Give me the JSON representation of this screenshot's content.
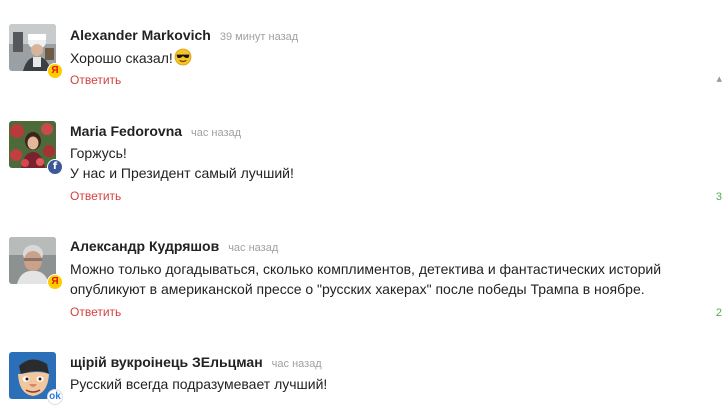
{
  "comments": [
    {
      "author": "Alexander Markovich",
      "time": "39 минут назад",
      "lines": [
        "Хорошо сказал!"
      ],
      "emoji": "sunglasses-emoji",
      "reply": "Ответить",
      "badge": "yandex-icon",
      "side_mark": "",
      "side_color": "#9a9a9a"
    },
    {
      "author": "Maria Fedorovna",
      "time": "час назад",
      "lines": [
        "Горжусь!",
        "У нас и Президент самый лучший!"
      ],
      "reply": "Ответить",
      "badge": "facebook-icon",
      "side_mark": "3",
      "side_color": "#4caf50"
    },
    {
      "author": "Александр Кудряшов",
      "time": "час назад",
      "lines": [
        "Можно только догадываться, сколько комплиментов, детектива и фантастических историй",
        "опубликуют в американской прессе о \"русских хакерах\" после победы Трампа в ноябре."
      ],
      "reply": "Ответить",
      "badge": "yandex-icon",
      "side_mark": "2",
      "side_color": "#4caf50"
    },
    {
      "author": "щірій вукроінець ЗЕльцман",
      "time": "час назад",
      "lines": [
        "Русский всегда подразумевает лучший!"
      ],
      "reply": "",
      "badge": "odnoklassniki-icon",
      "side_mark": "",
      "side_color": "#9a9a9a"
    }
  ],
  "colors": {
    "reply": "#d33f3f",
    "time": "#a0a0a0",
    "text": "#222222"
  }
}
